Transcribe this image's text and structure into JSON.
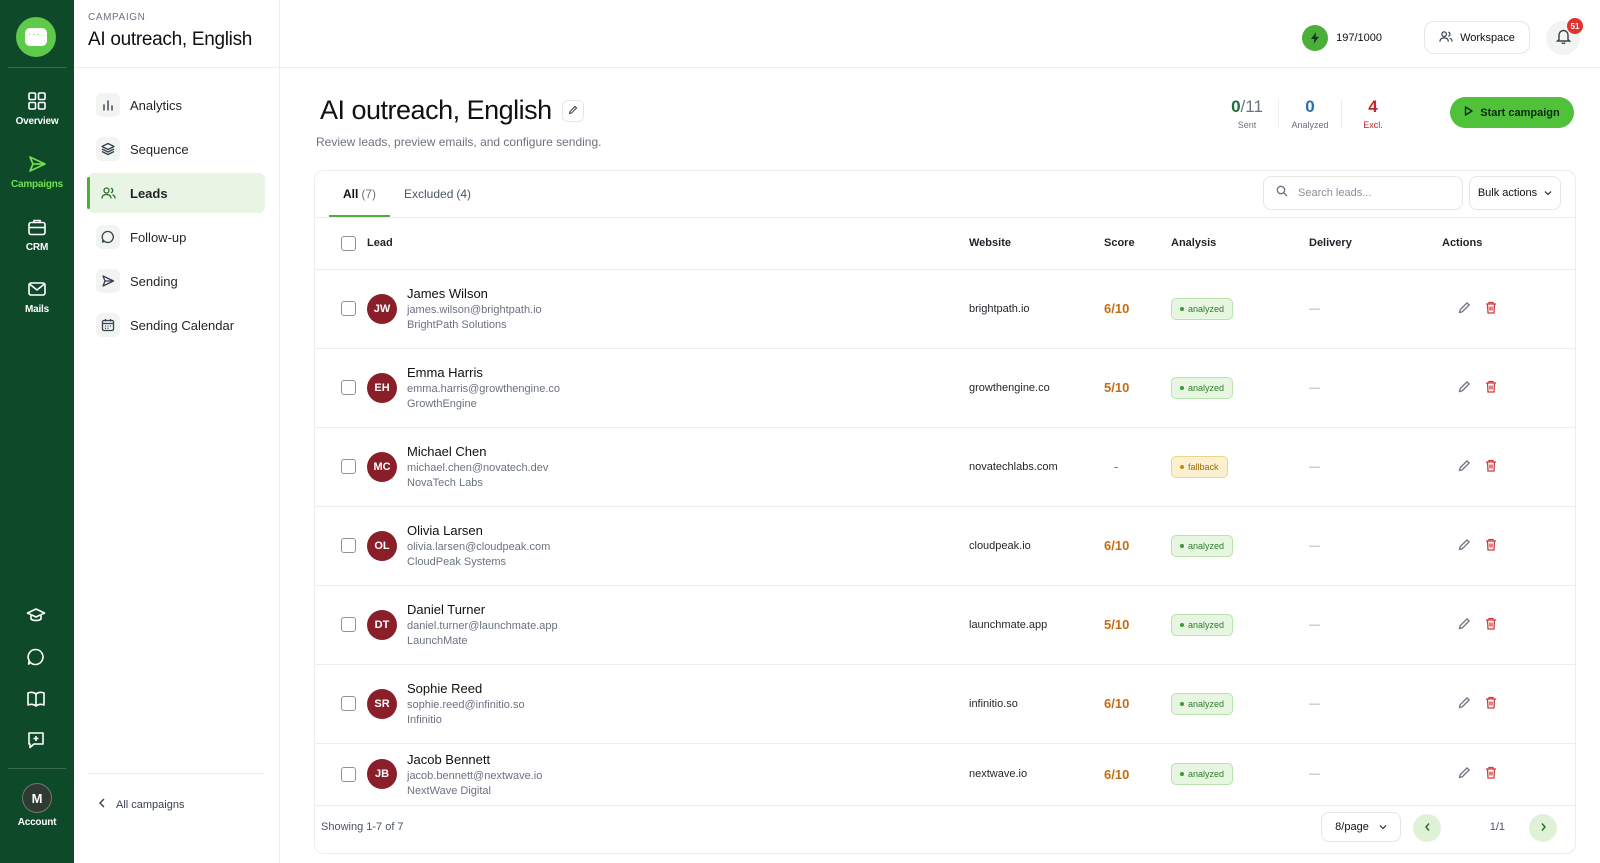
{
  "rail": {
    "items": [
      {
        "label": "Overview",
        "icon": "grid-icon"
      },
      {
        "label": "Campaigns",
        "icon": "send-icon"
      },
      {
        "label": "CRM",
        "icon": "briefcase-icon"
      },
      {
        "label": "Mails",
        "icon": "mail-icon"
      }
    ],
    "account": {
      "initial": "M",
      "label": "Account"
    }
  },
  "sidebar": {
    "eyebrow": "CAMPAIGN",
    "title": "AI outreach, English",
    "items": [
      {
        "label": "Analytics"
      },
      {
        "label": "Sequence"
      },
      {
        "label": "Leads"
      },
      {
        "label": "Follow-up"
      },
      {
        "label": "Sending"
      },
      {
        "label": "Sending Calendar"
      }
    ],
    "back_label": "All campaigns"
  },
  "topbar": {
    "credits": "197/1000",
    "workspace_label": "Workspace",
    "notifications_count": "51"
  },
  "page": {
    "title": "AI outreach, English",
    "subtitle": "Review leads, preview emails, and configure sending.",
    "stats": {
      "sent_value": "0",
      "sent_total": "/11",
      "sent_label": "Sent",
      "analyzed_value": "0",
      "analyzed_label": "Analyzed",
      "excluded_value": "4",
      "excluded_label": "Excl."
    },
    "start_label": "Start campaign"
  },
  "tabs": [
    {
      "label": "All",
      "count": "(7)"
    },
    {
      "label": "Excluded",
      "count": "(4)"
    }
  ],
  "search": {
    "placeholder": "Search leads..."
  },
  "bulk_label": "Bulk actions",
  "columns": {
    "lead": "Lead",
    "website": "Website",
    "score": "Score",
    "analysis": "Analysis",
    "delivery": "Delivery",
    "actions": "Actions"
  },
  "leads": [
    {
      "initials": "JW",
      "name": "James Wilson",
      "email": "james.wilson@brightpath.io",
      "company": "BrightPath Solutions",
      "website": "brightpath.io",
      "score": "6/10",
      "analysis": "analyzed",
      "delivery": "—"
    },
    {
      "initials": "EH",
      "name": "Emma Harris",
      "email": "emma.harris@growthengine.co",
      "company": "GrowthEngine",
      "website": "growthengine.co",
      "score": "5/10",
      "analysis": "analyzed",
      "delivery": "—"
    },
    {
      "initials": "MC",
      "name": "Michael Chen",
      "email": "michael.chen@novatech.dev",
      "company": "NovaTech Labs",
      "website": "novatechlabs.com",
      "score": "-",
      "analysis": "fallback",
      "delivery": "—"
    },
    {
      "initials": "OL",
      "name": "Olivia Larsen",
      "email": "olivia.larsen@cloudpeak.com",
      "company": "CloudPeak Systems",
      "website": "cloudpeak.io",
      "score": "6/10",
      "analysis": "analyzed",
      "delivery": "—"
    },
    {
      "initials": "DT",
      "name": "Daniel Turner",
      "email": "daniel.turner@launchmate.app",
      "company": "LaunchMate",
      "website": "launchmate.app",
      "score": "5/10",
      "analysis": "analyzed",
      "delivery": "—"
    },
    {
      "initials": "SR",
      "name": "Sophie Reed",
      "email": "sophie.reed@infinitio.so",
      "company": "Infinitio",
      "website": "infinitio.so",
      "score": "6/10",
      "analysis": "analyzed",
      "delivery": "—"
    },
    {
      "initials": "JB",
      "name": "Jacob Bennett",
      "email": "jacob.bennett@nextwave.io",
      "company": "NextWave Digital",
      "website": "nextwave.io",
      "score": "6/10",
      "analysis": "analyzed",
      "delivery": "—"
    }
  ],
  "footer": {
    "showing": "Showing 1-7 of 7",
    "per_page": "8/page",
    "page": "1/1"
  },
  "colors": {
    "rail_bg": "#0e4a2a",
    "accent": "#4fc23a",
    "avatar": "#8a1f2a",
    "score": "#c86b12",
    "excluded": "#c0262d"
  }
}
